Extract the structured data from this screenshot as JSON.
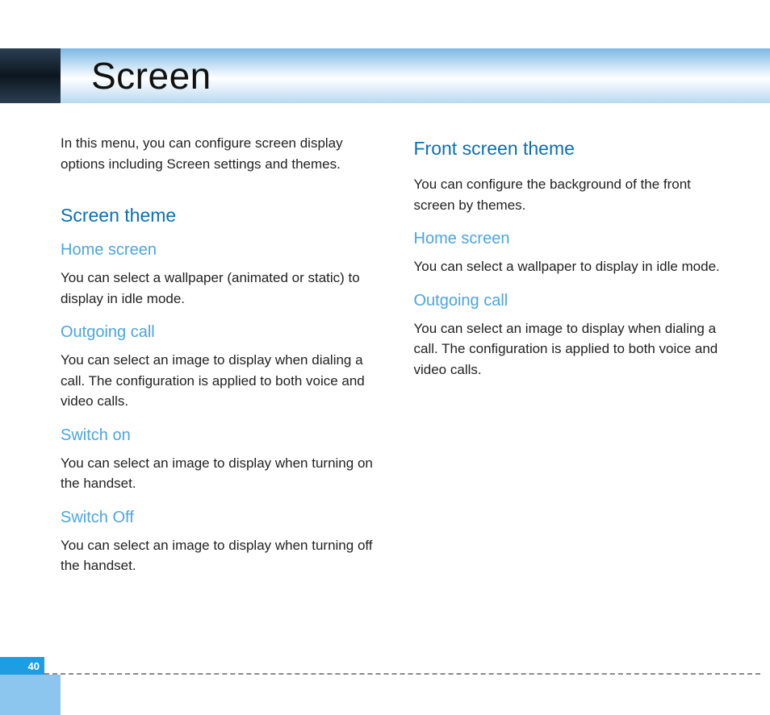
{
  "header": {
    "title": "Screen"
  },
  "left": {
    "intro": "In this menu, you can configure screen display options including Screen settings and themes.",
    "section": "Screen theme",
    "items": [
      {
        "h": "Home screen",
        "p": "You can select a wallpaper (animated or static) to display in idle mode."
      },
      {
        "h": "Outgoing call",
        "p": "You can select an image to display when dialing a call.\nThe configuration is applied to both voice and video calls."
      },
      {
        "h": "Switch on",
        "p": "You can select an image to display when turning on the handset."
      },
      {
        "h": "Switch Off",
        "p": "You can select an image to display when turning off the handset."
      }
    ]
  },
  "right": {
    "section": "Front screen theme",
    "intro": "You can configure the background of the front screen by themes.",
    "items": [
      {
        "h": "Home screen",
        "p": "You can select a wallpaper to display in idle mode."
      },
      {
        "h": "Outgoing call",
        "p": "You can select an image to display when dialing a call.\nThe configuration is applied to both voice and video calls."
      }
    ]
  },
  "footer": {
    "page": "40"
  }
}
